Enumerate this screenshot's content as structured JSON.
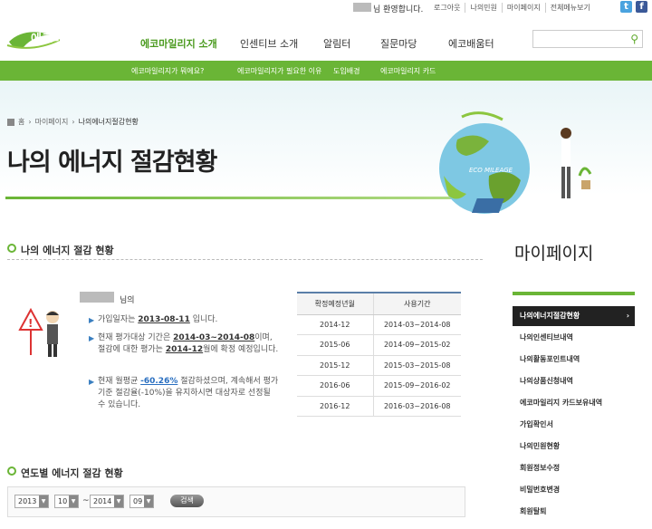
{
  "util": {
    "welcome": "님 환영합니다.",
    "links": [
      "로그아웃",
      "나의민원",
      "마이페이지",
      "전체메뉴보기"
    ],
    "twitter": "t",
    "facebook": "f"
  },
  "logo": {
    "text": "에코마일리지"
  },
  "gnb": [
    "에코마일리지 소개",
    "인센티브 소개",
    "알림터",
    "질문마당",
    "에코배움터"
  ],
  "search": {
    "placeholder": ""
  },
  "subnav": [
    "에코마일리지가 뭐에요?",
    "에코마일리지가 필요한 이유",
    "도입배경",
    "에코마일리지 카드"
  ],
  "breadcrumb": {
    "home": "홈",
    "mypage": "마이페이지",
    "current": "나의에너지절감현황"
  },
  "hero": {
    "title": "나의 에너지 절감현황",
    "globe_text": "ECO MILEAGE"
  },
  "section1": {
    "title": "나의 에너지 절감 현황",
    "nim": "님의",
    "join_prefix": "가입일자는 ",
    "join_date": "2013-08-11",
    "join_suffix": " 입니다.",
    "eval_a": "현재 평가대상 기간은 ",
    "eval_period": "2014-03~2014-08",
    "eval_b": "이며, 절감에 대한 평가는 ",
    "eval_month": "2014-12",
    "eval_c": "월에 확정 예정입니다.",
    "rate_a": "현재 월평균 ",
    "rate": "-60.26%",
    "rate_b": " 절감하셨으며, 계속해서 평가기준 절감율(-10%)을 유지하시면 대상자로 선정될 수 있습니다."
  },
  "table": {
    "headers": [
      "확정예정년월",
      "사용기간"
    ],
    "rows": [
      [
        "2014-12",
        "2014-03~2014-08"
      ],
      [
        "2015-06",
        "2014-09~2015-02"
      ],
      [
        "2015-12",
        "2015-03~2015-08"
      ],
      [
        "2016-06",
        "2015-09~2016-02"
      ],
      [
        "2016-12",
        "2016-03~2016-08"
      ]
    ]
  },
  "section2": {
    "title": "연도별 에너지 절감 현황",
    "from_year": "2013",
    "from_month": "10",
    "tilde": "~",
    "to_year": "2014",
    "to_month": "09",
    "search_label": "검색"
  },
  "sidebar": {
    "title": "마이페이지",
    "items": [
      "나의에너지절감현황",
      "나의인센티브내역",
      "나의활동포인트내역",
      "나의상품신청내역",
      "에코마일리지 카드보유내역",
      "가입확인서",
      "나의민원현황",
      "회원정보수정",
      "비밀번호변경",
      "회원탈퇴"
    ],
    "active_chevron": "›"
  },
  "colors": {
    "brand_green": "#6ab536",
    "table_header_line": "#5a7fa8",
    "highlight_blue": "#2a6fc0"
  }
}
